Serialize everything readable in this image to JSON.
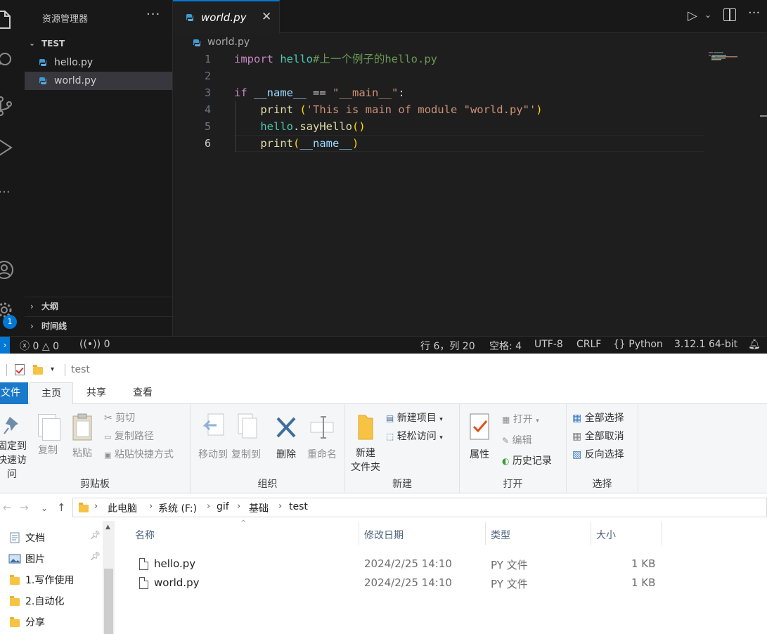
{
  "vscode": {
    "explorer_title": "资源管理器",
    "more": "···",
    "folder": "TEST",
    "files": [
      {
        "name": "hello.py"
      },
      {
        "name": "world.py"
      }
    ],
    "outline_label": "大纲",
    "timeline_label": "时间线",
    "badge": "1",
    "tab": {
      "name": "world.py",
      "close": "✕"
    },
    "breadcrumb": "world.py",
    "code_lines": [
      {
        "n": "1"
      },
      {
        "n": "2"
      },
      {
        "n": "3"
      },
      {
        "n": "4"
      },
      {
        "n": "5"
      },
      {
        "n": "6"
      }
    ],
    "code": {
      "l1_kw": "import",
      "l1_mod": " hello",
      "l1_cm": "#上一个例子的hello.py",
      "l3_kw": "if",
      "l3_a": " __name__",
      "l3_b": " == ",
      "l3_c": "\"__main__\"",
      "l3_d": ":",
      "l4_fn": "    print",
      "l4_b": " (",
      "l4_s": "'This is main of module \"world.py\"'",
      "l4_e": ")",
      "l5_v": "    hello",
      "l5_d": ".",
      "l5_fn": "sayHello",
      "l5_p": "()",
      "l6_fn": "    print",
      "l6_o": "(",
      "l6_v": "__name__",
      "l6_c": ")"
    },
    "status": {
      "errors": "0",
      "warnings": "0",
      "ports": "0",
      "position": "行 6，列 20",
      "spaces": "空格: 4",
      "encoding": "UTF-8",
      "eol": "CRLF",
      "language": "Python",
      "interpreter": "3.12.1 64-bit"
    }
  },
  "explorer": {
    "window_title": "test",
    "ribbon_tabs": {
      "file": "文件",
      "home": "主页",
      "share": "共享",
      "view": "查看"
    },
    "clipboard": {
      "pin_line1": "固定到",
      "pin_line2": "快速访问",
      "copy": "复制",
      "paste": "粘贴",
      "cut": "剪切",
      "copy_path": "复制路径",
      "paste_shortcut": "粘贴快捷方式",
      "label": "剪贴板"
    },
    "organize": {
      "move_to": "移动到",
      "copy_to": "复制到",
      "delete": "删除",
      "rename": "重命名",
      "label": "组织"
    },
    "new_group": {
      "new_folder_1": "新建",
      "new_folder_2": "文件夹",
      "new_item": "新建项目",
      "easy_access": "轻松访问",
      "label": "新建"
    },
    "open_group": {
      "properties": "属性",
      "open": "打开",
      "edit": "编辑",
      "history": "历史记录",
      "label": "打开"
    },
    "select_group": {
      "select_all": "全部选择",
      "select_none": "全部取消",
      "invert": "反向选择",
      "label": "选择"
    },
    "address": [
      "此电脑",
      "系统 (F:)",
      "gif",
      "基础",
      "test"
    ],
    "nav_items": [
      {
        "label": "文档",
        "pinned": true
      },
      {
        "label": "图片",
        "pinned": true
      },
      {
        "label": "1.写作使用",
        "pinned": false
      },
      {
        "label": "2.自动化",
        "pinned": false
      },
      {
        "label": "分享",
        "pinned": false
      }
    ],
    "columns": {
      "name": "名称",
      "modified": "修改日期",
      "type": "类型",
      "size": "大小"
    },
    "files": [
      {
        "name": "hello.py",
        "modified": "2024/2/25 14:10",
        "type": "PY 文件",
        "size": "1 KB"
      },
      {
        "name": "world.py",
        "modified": "2024/2/25 14:10",
        "type": "PY 文件",
        "size": "1 KB"
      }
    ]
  }
}
